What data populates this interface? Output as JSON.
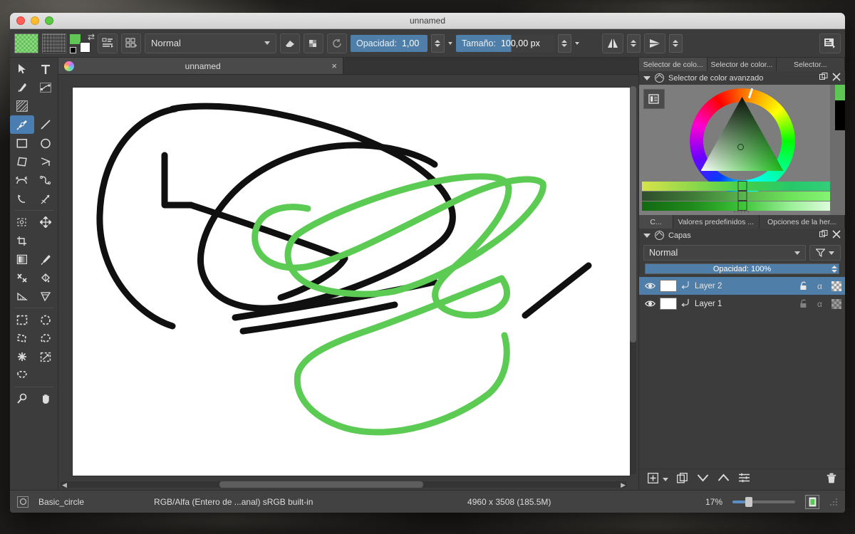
{
  "window": {
    "title": "unnamed"
  },
  "toolbar": {
    "swatch_gradient_name": "gradient-preset-swatch",
    "pattern_name": "pattern-preset-swatch",
    "blend_mode": "Normal",
    "eraser_label": "eraser-toggle",
    "alpha_label": "preserve-alpha-toggle",
    "reset_label": "reset-rotation",
    "opacity_label": "Opacidad:",
    "opacity_value": "1,00",
    "size_label": "Tamaño:",
    "size_value": "100,00 px",
    "mirror_h_label": "mirror-horizontal",
    "mirror_v_label": "mirror-vertical",
    "workspace_label": "workspace-chooser"
  },
  "tools": [
    {
      "name": "select-shapes-tool",
      "glyph": "cursor"
    },
    {
      "name": "text-tool",
      "glyph": "T"
    },
    {
      "name": "calligraphy-tool",
      "glyph": "pen"
    },
    {
      "name": "edit-shapes-tool",
      "glyph": "node"
    },
    {
      "name": "fill-gradient-tool",
      "glyph": "hatch"
    },
    {
      "name": "freehand-brush-tool",
      "glyph": "brush",
      "selected": true
    },
    {
      "name": "line-tool",
      "glyph": "line"
    },
    {
      "name": "rectangle-tool",
      "glyph": "rect"
    },
    {
      "name": "ellipse-tool",
      "glyph": "ellipse"
    },
    {
      "name": "polygon-tool",
      "glyph": "poly"
    },
    {
      "name": "polyline-tool",
      "glyph": "polyline"
    },
    {
      "name": "bezier-curve-tool",
      "glyph": "bezier"
    },
    {
      "name": "freehand-path-tool",
      "glyph": "path"
    },
    {
      "name": "dynamic-brush-tool",
      "glyph": "dynamic"
    },
    {
      "name": "multibrush-tool",
      "glyph": "multibrush"
    },
    {
      "name": "transform-tool",
      "glyph": "transform"
    },
    {
      "name": "move-tool",
      "glyph": "move"
    },
    {
      "name": "crop-tool",
      "glyph": "crop"
    },
    {
      "name": "gradient-tool",
      "glyph": "grad"
    },
    {
      "name": "color-picker-tool",
      "glyph": "dropper"
    },
    {
      "name": "colorize-mask-tool",
      "glyph": "colorize"
    },
    {
      "name": "fill-tool",
      "glyph": "bucket"
    },
    {
      "name": "measure-tool",
      "glyph": "measure"
    },
    {
      "name": "assistant-tool",
      "glyph": "assistant"
    },
    {
      "name": "rectangular-selection-tool",
      "glyph": "selrect"
    },
    {
      "name": "elliptical-selection-tool",
      "glyph": "selellipse"
    },
    {
      "name": "polygonal-selection-tool",
      "glyph": "selpoly"
    },
    {
      "name": "freehand-selection-tool",
      "glyph": "sellasso"
    },
    {
      "name": "magic-wand-selection-tool",
      "glyph": "wand"
    },
    {
      "name": "similar-color-selection-tool",
      "glyph": "simcolor"
    },
    {
      "name": "bezier-selection-tool",
      "glyph": "selbezier"
    },
    {
      "name": "zoom-tool",
      "glyph": "zoom"
    },
    {
      "name": "pan-tool",
      "glyph": "hand"
    }
  ],
  "document_tab": {
    "name": "unnamed",
    "close_label": "×"
  },
  "color_selector": {
    "tabs": [
      "Selector de colo...",
      "Selector de color...",
      "Selector..."
    ],
    "active_tab_index": 0,
    "panel_title": "Selector de color avanzado",
    "float_label": "float-panel",
    "close_label": "close-panel"
  },
  "layers_panel": {
    "tabs": [
      "C...",
      "Valores predefinidos ...",
      "Opciones de la her..."
    ],
    "active_tab_index": 0,
    "panel_title": "Capas",
    "blend_mode": "Normal",
    "opacity_text": "Opacidad:  100%",
    "columns": [
      "visibility",
      "thumbnail",
      "inherit-alpha",
      "name",
      "lock",
      "alpha",
      "alpha-lock"
    ],
    "rows": [
      {
        "name": "Layer 2",
        "selected": true,
        "visible": true,
        "thumb": "art"
      },
      {
        "name": "Layer 1",
        "selected": false,
        "visible": true,
        "thumb": "white"
      }
    ],
    "buttons": [
      {
        "name": "add-layer-button",
        "glyph": "plus"
      },
      {
        "name": "add-layer-dropdown",
        "glyph": "caret"
      },
      {
        "name": "duplicate-layer-button",
        "glyph": "copy"
      },
      {
        "name": "move-layer-down-button",
        "glyph": "down"
      },
      {
        "name": "move-layer-up-button",
        "glyph": "up"
      },
      {
        "name": "layer-properties-button",
        "glyph": "sliders"
      },
      {
        "name": "delete-layer-button",
        "glyph": "trash"
      }
    ]
  },
  "status_bar": {
    "brush_preset": "Basic_circle",
    "color_model": "RGB/Alfa (Entero de ...anal)  sRGB built-in",
    "image_size": "4960 x 3508 (185.5M)",
    "zoom_level": "17%",
    "fit_button": "fit-to-page-button"
  },
  "colors": {
    "foreground": "#62c656",
    "background": "#ffffff",
    "accent": "#4f7ea8",
    "panel_bg": "#3c3c3c",
    "stroke_black": "#101010",
    "stroke_green": "#5ccb53",
    "canvas_white": "#ffffff"
  },
  "artwork": {
    "description": "freehand scribble on white canvas",
    "black_strokes": [
      "M232,140 C175,150 128,205 126,290 C124,372 180,430 228,445",
      "M228,140 C300,126 440,150 545,205 C625,250 640,300 600,330",
      "M600,330 C555,365 470,400 400,415 C330,430 282,410 270,370",
      "M270,370 C258,330 290,270 340,235 C392,198 470,180 545,198",
      "M545,198 C580,206 596,218 596,218",
      "M217,205 L217,275 L254,275",
      "M254,275 C330,300 420,330 470,350",
      "M470,350 C460,368 420,392 380,405",
      "M316,433 C400,420 520,400 596,383",
      "M327,452 C400,442 470,430 540,415",
      "M723,430 L812,360"
    ],
    "green_strokes": [
      "M418,280 C380,272 348,285 344,315 C340,348 372,368 414,362",
      "M414,362 C470,352 560,300 640,262 C700,235 740,235 748,245",
      "M748,245 C752,262 720,300 676,330 C630,362 580,386 540,396",
      "M540,396 C500,404 440,400 412,382 C382,362 386,330 404,316",
      "M404,316 C440,290 540,250 620,238 C680,230 700,238 700,252",
      "M700,252 C700,285 660,330 620,365 C598,385 592,400 600,412",
      "M600,412 C614,432 660,436 684,420 C702,408 700,392 690,378",
      "M690,378 C660,390 580,424 500,452 C440,472 410,490 404,512",
      "M404,512 C398,548 430,578 478,590 C540,604 620,580 672,540",
      "M672,540 C700,515 700,480 694,458"
    ]
  }
}
